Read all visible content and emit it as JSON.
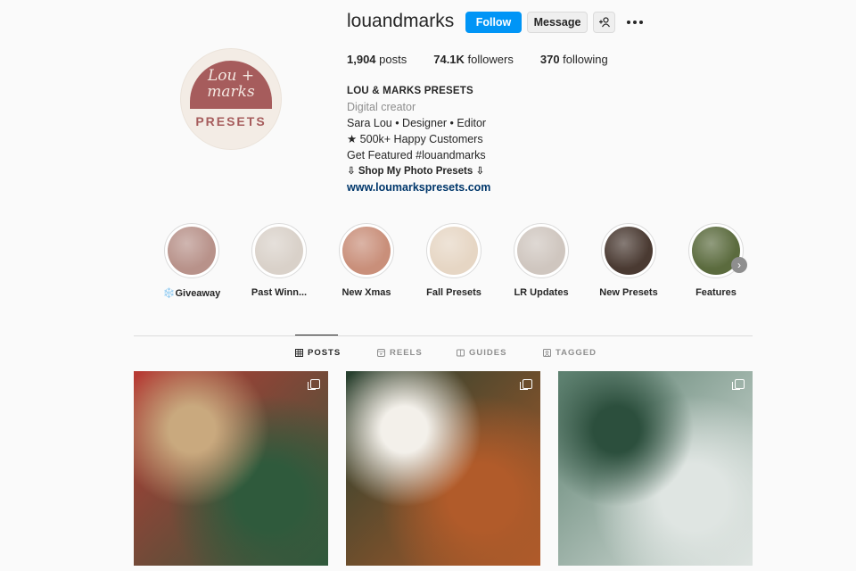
{
  "profile": {
    "username": "louandmarks",
    "avatar": {
      "script_line1": "Lou +",
      "script_line2": "marks",
      "subtitle": "PRESETS"
    },
    "buttons": {
      "follow": "Follow",
      "message": "Message",
      "add_icon": "add-user-icon",
      "more_icon": "more-icon"
    },
    "stats": {
      "posts_count": "1,904",
      "posts_label": " posts",
      "followers_count": "74.1K",
      "followers_label": " followers",
      "following_count": "370",
      "following_label": " following"
    },
    "bio": {
      "name": "LOU & MARKS PRESETS",
      "category": "Digital creator",
      "line1": "Sara Lou • Designer • Editor",
      "line2": "★ 500k+ Happy Customers",
      "line3": "Get Featured #louandmarks",
      "line4": "⇩ Shop My Photo Presets ⇩",
      "link": "www.loumarkspresets.com"
    }
  },
  "highlights": [
    {
      "label": "❄️Giveaway",
      "color": "#b8928a"
    },
    {
      "label": "Past Winn...",
      "color": "#d9d1c9"
    },
    {
      "label": "New Xmas",
      "color": "#c98f7a"
    },
    {
      "label": "Fall Presets",
      "color": "#e6d6c4"
    },
    {
      "label": "LR Updates",
      "color": "#cfc6bf"
    },
    {
      "label": "New Presets",
      "color": "#4a3a32"
    },
    {
      "label": "Features",
      "color": "#5b6b3e"
    }
  ],
  "tabs": [
    {
      "label": "POSTS",
      "icon": "grid-icon",
      "active": true
    },
    {
      "label": "REELS",
      "icon": "reels-icon",
      "active": false
    },
    {
      "label": "GUIDES",
      "icon": "guides-icon",
      "active": false
    },
    {
      "label": "TAGGED",
      "icon": "tagged-icon",
      "active": false
    }
  ],
  "posts": [
    {
      "description": "gifts-and-tree",
      "colors": [
        "#b93a34",
        "#2f5a3c",
        "#c9a97e"
      ],
      "multi": true
    },
    {
      "description": "mug-with-bokeh",
      "colors": [
        "#26402f",
        "#b15b2a",
        "#f3f0ea"
      ],
      "multi": true
    },
    {
      "description": "decorated-tree",
      "colors": [
        "#5b7f6e",
        "#dfe5e2",
        "#2c4f3d"
      ],
      "multi": true
    }
  ]
}
